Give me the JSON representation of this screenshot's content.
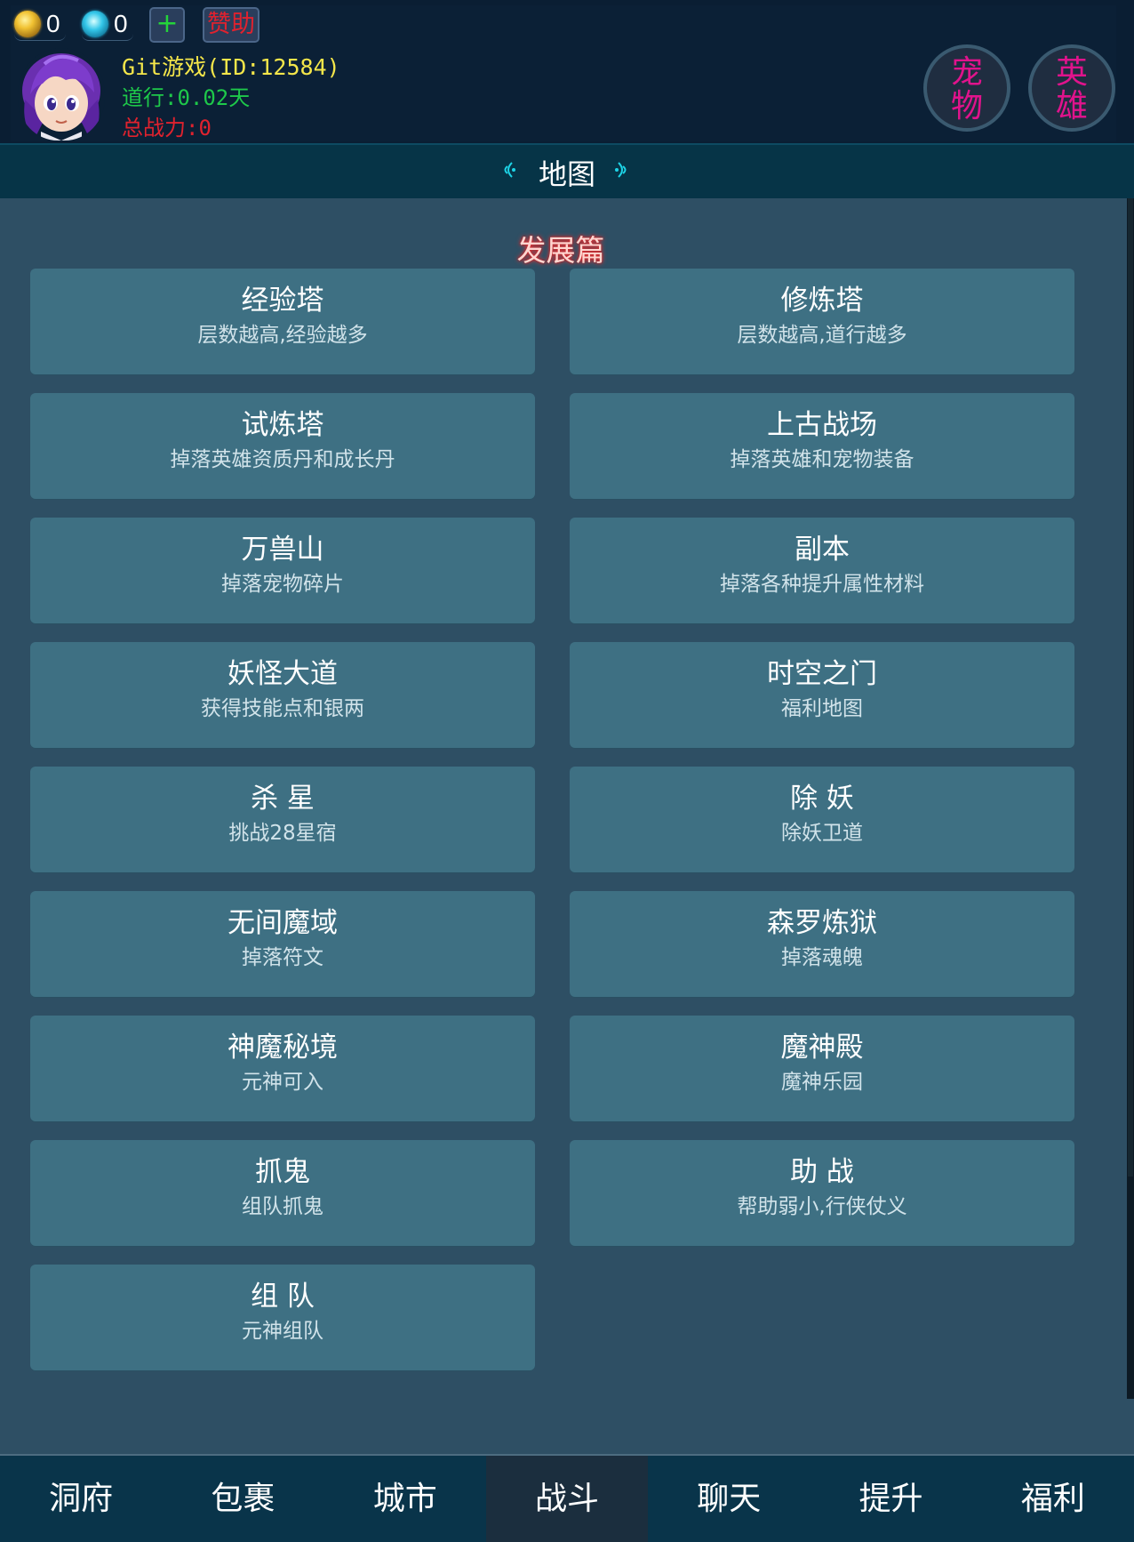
{
  "header": {
    "gold": "0",
    "gems": "0",
    "plus_label": "+",
    "sponsor_label": "赞助",
    "player_name": "Git游戏(ID:12584)",
    "daoxing": "道行:0.02天",
    "total_power": "总战力:0",
    "pet_button": [
      "宠",
      "物"
    ],
    "hero_button": [
      "英",
      "雄"
    ]
  },
  "title": "地图",
  "section_title": "发展篇",
  "cards": [
    {
      "title": "经验塔",
      "desc": "层数越高,经验越多"
    },
    {
      "title": "修炼塔",
      "desc": "层数越高,道行越多"
    },
    {
      "title": "试炼塔",
      "desc": "掉落英雄资质丹和成长丹"
    },
    {
      "title": "上古战场",
      "desc": "掉落英雄和宠物装备"
    },
    {
      "title": "万兽山",
      "desc": "掉落宠物碎片"
    },
    {
      "title": "副本",
      "desc": "掉落各种提升属性材料"
    },
    {
      "title": "妖怪大道",
      "desc": "获得技能点和银两"
    },
    {
      "title": "时空之门",
      "desc": "福利地图"
    },
    {
      "title": "杀 星",
      "desc": "挑战28星宿"
    },
    {
      "title": "除 妖",
      "desc": "除妖卫道"
    },
    {
      "title": "无间魔域",
      "desc": "掉落符文"
    },
    {
      "title": "森罗炼狱",
      "desc": "掉落魂魄"
    },
    {
      "title": "神魔秘境",
      "desc": "元神可入"
    },
    {
      "title": "魔神殿",
      "desc": "魔神乐园"
    },
    {
      "title": "抓鬼",
      "desc": "组队抓鬼"
    },
    {
      "title": "助 战",
      "desc": "帮助弱小,行侠仗义"
    },
    {
      "title": "组 队",
      "desc": "元神组队"
    }
  ],
  "nav": [
    {
      "label": "洞府",
      "active": false
    },
    {
      "label": "包裹",
      "active": false
    },
    {
      "label": "城市",
      "active": false
    },
    {
      "label": "战斗",
      "active": true
    },
    {
      "label": "聊天",
      "active": false
    },
    {
      "label": "提升",
      "active": false
    },
    {
      "label": "福利",
      "active": false
    }
  ],
  "colors": {
    "card_bg": "#3e7083",
    "main_bg": "#2e4f64",
    "name_yellow": "#f4e64a",
    "daoxing_green": "#1ec84a",
    "power_red": "#e0222e",
    "round_button_text": "#e0138c"
  },
  "icons": {
    "gold": "gold-coin-icon",
    "gem": "spiral-gem-icon",
    "avatar": "purple-haired-hero-avatar"
  }
}
